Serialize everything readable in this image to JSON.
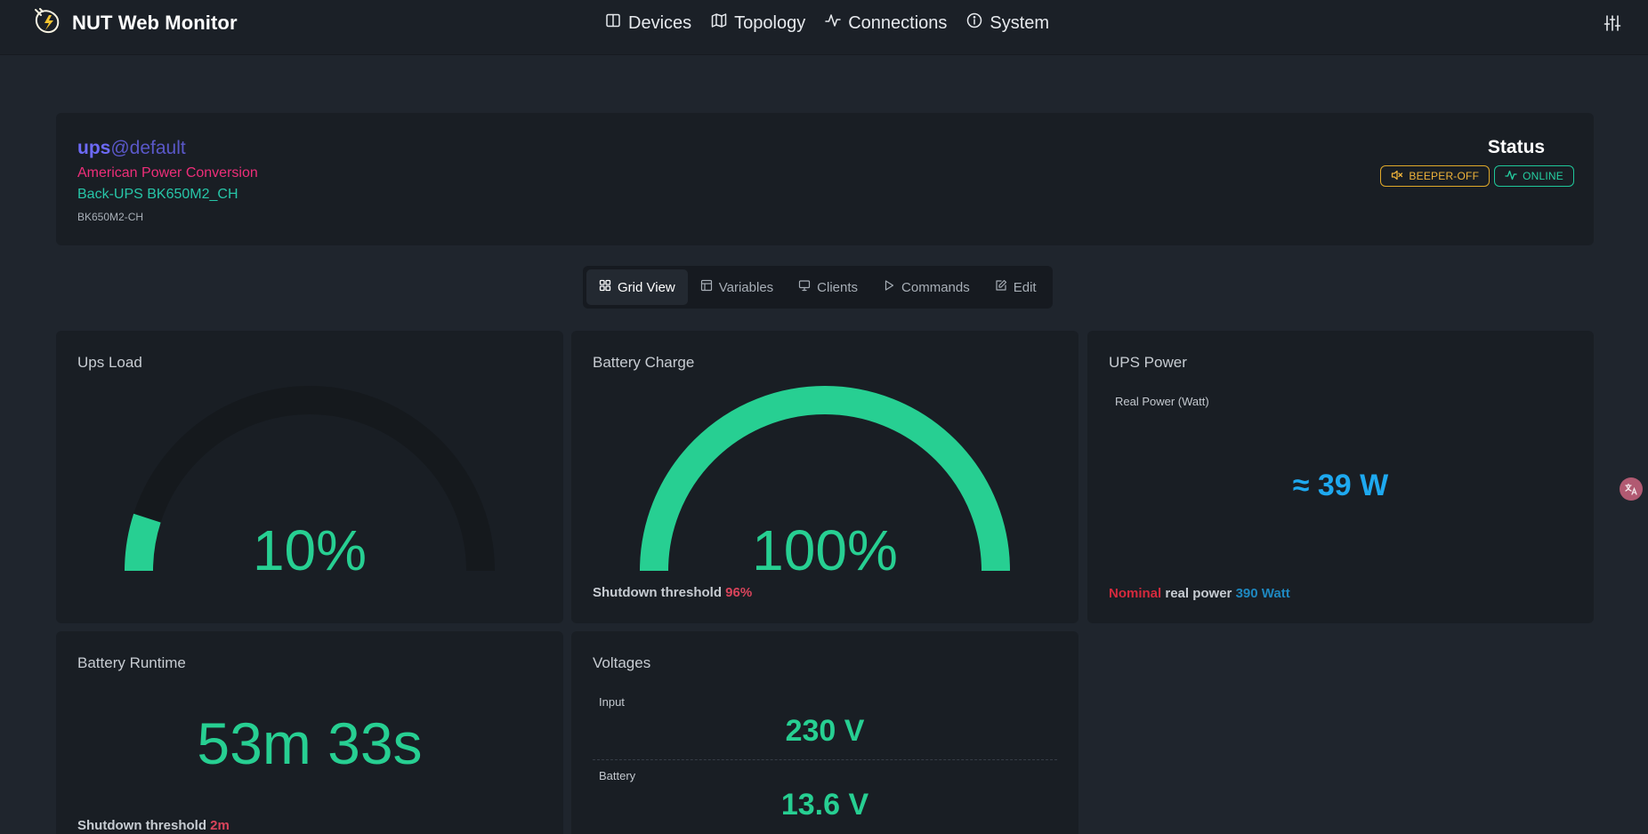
{
  "app": {
    "title": "NUT Web Monitor"
  },
  "nav": [
    {
      "label": "Devices",
      "icon": "book-icon"
    },
    {
      "label": "Topology",
      "icon": "map-icon"
    },
    {
      "label": "Connections",
      "icon": "activity-icon"
    },
    {
      "label": "System",
      "icon": "info-icon"
    }
  ],
  "device": {
    "name": "ups",
    "host": "@default",
    "manufacturer": "American Power Conversion",
    "model": "Back-UPS BK650M2_CH",
    "serial": "BK650M2-CH"
  },
  "status": {
    "title": "Status",
    "badges": [
      {
        "label": "BEEPER-OFF",
        "icon": "speaker-mute-icon",
        "color": "#e0a92a"
      },
      {
        "label": "ONLINE",
        "icon": "activity-icon",
        "color": "#1fc79a"
      }
    ]
  },
  "tabs": [
    {
      "label": "Grid View",
      "icon": "grid-icon",
      "active": true
    },
    {
      "label": "Variables",
      "icon": "table-icon",
      "active": false
    },
    {
      "label": "Clients",
      "icon": "monitor-icon",
      "active": false
    },
    {
      "label": "Commands",
      "icon": "play-icon",
      "active": false
    },
    {
      "label": "Edit",
      "icon": "edit-icon",
      "active": false
    }
  ],
  "tiles": {
    "load": {
      "title": "Ups Load",
      "value_text": "10%",
      "value": 10
    },
    "charge": {
      "title": "Battery Charge",
      "value_text": "100%",
      "value": 100,
      "threshold_label": "Shutdown threshold",
      "threshold_value": "96%"
    },
    "power": {
      "title": "UPS Power",
      "label": "Real Power (Watt)",
      "value_text": "≈ 39 W",
      "note_nominal": "Nominal",
      "note_middle": "real power",
      "note_value": "390 Watt"
    },
    "runtime": {
      "title": "Battery Runtime",
      "value_text": "53m 33s",
      "threshold_label": "Shutdown threshold",
      "threshold_value": "2m"
    },
    "voltages": {
      "title": "Voltages",
      "input_label": "Input",
      "input_value": "230 V",
      "battery_label": "Battery",
      "battery_value": "13.6 V"
    }
  },
  "colors": {
    "accent_green": "#27cf92",
    "gauge_track": "#15191d",
    "background": "#1f252d",
    "card": "#191e24"
  }
}
